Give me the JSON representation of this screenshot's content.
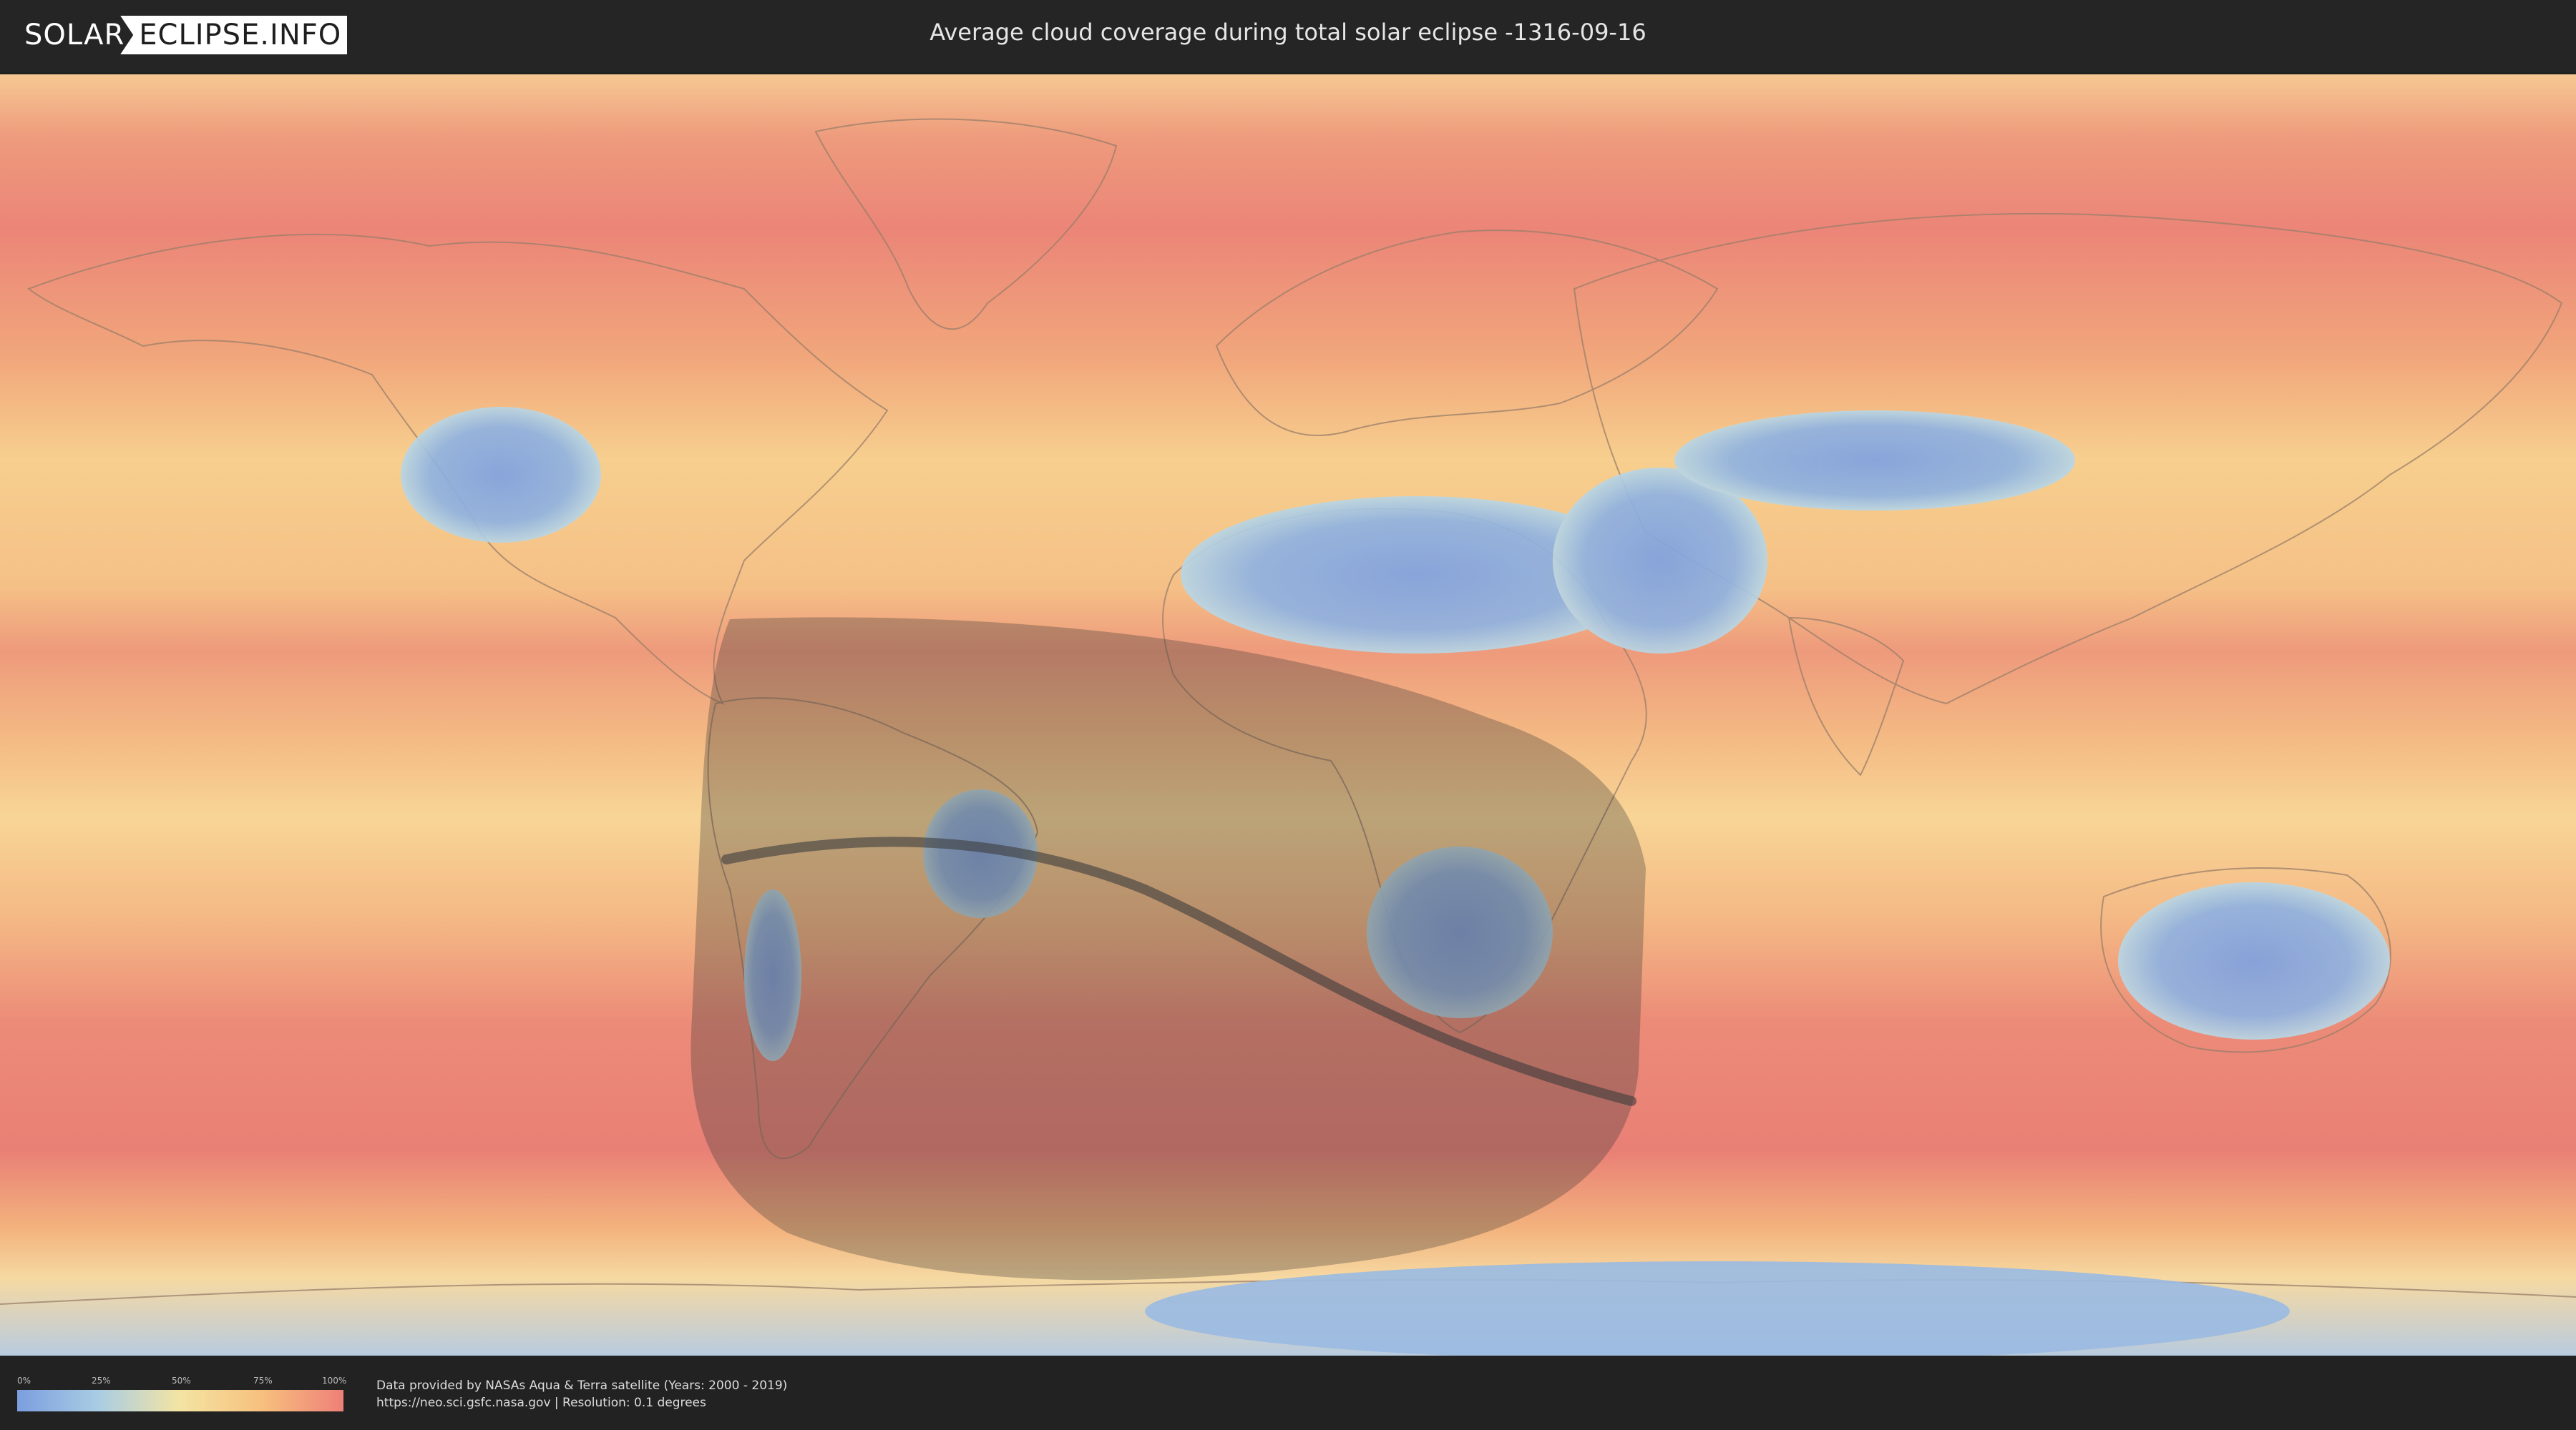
{
  "header": {
    "logo_part1": "SOLAR",
    "logo_part2": "ECLIPSE.INFO",
    "title": "Average cloud coverage during total solar eclipse -1316-09-16"
  },
  "legend": {
    "ticks": [
      "0%",
      "25%",
      "50%",
      "75%",
      "100%"
    ],
    "colors": [
      "#7b9ee0",
      "#a9cde3",
      "#f4e4a2",
      "#f7c07e",
      "#ee8078"
    ]
  },
  "credits": {
    "line1": "Data provided by NASAs Aqua & Terra satellite (Years: 2000 - 2019)",
    "line2": "https://neo.sci.gsfc.nasa.gov | Resolution: 0.1 degrees"
  },
  "map": {
    "ocean_color": "#f3b079",
    "cloudy_band_color": "#ec8b78",
    "clear_land_color": "#86a8e0",
    "eclipse_shadow_color": "#333333",
    "centerline_color": "#3c3c3c"
  }
}
